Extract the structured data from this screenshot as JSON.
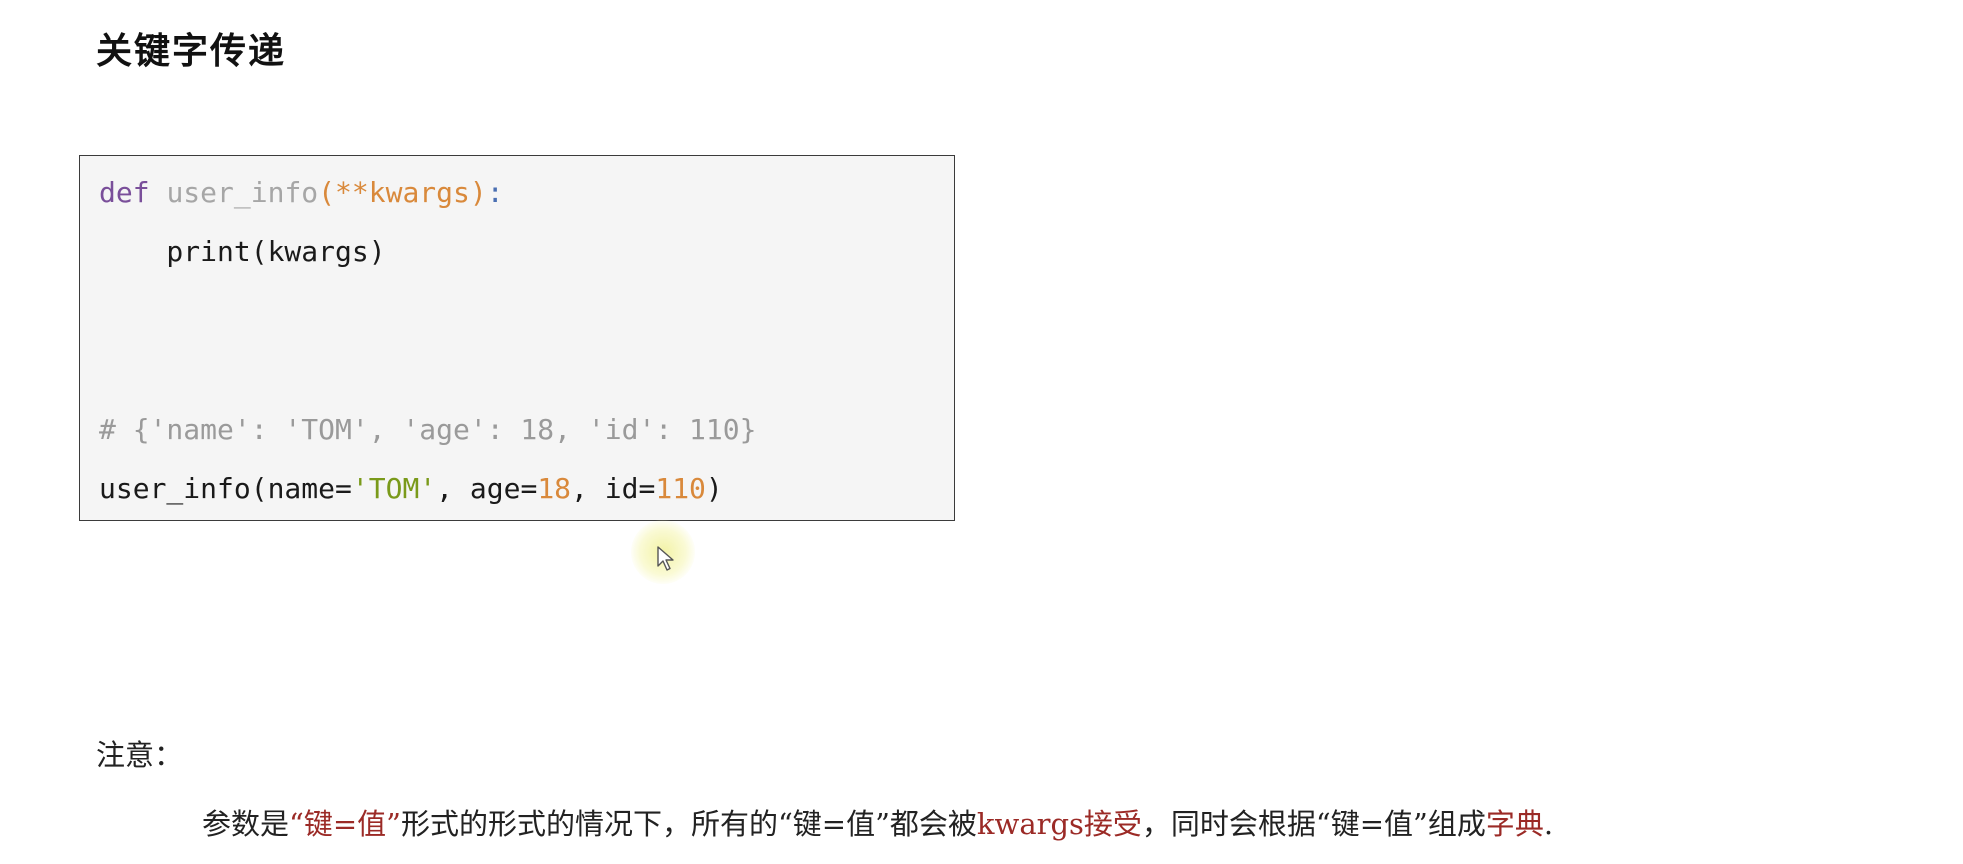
{
  "heading": "关键字传递",
  "code": {
    "line1": {
      "keyword": "def",
      "func_name": "user_info",
      "params": "(**kwargs)",
      "colon": ":"
    },
    "line2": "    print(kwargs)",
    "line3": "# {'name': 'TOM', 'age': 18, 'id': 110}",
    "line4": {
      "prefix": "user_info(name=",
      "str_val": "'TOM'",
      "mid1": ", age=",
      "num1": "18",
      "mid2": ", id=",
      "num2": "110",
      "suffix": ")"
    }
  },
  "note": {
    "label": "注意：",
    "seg1": "参数是",
    "hl1": "“键=值”",
    "seg2": "形式的形式的情况下，所有的“键=值”都会被",
    "hl2": "kwargs接受",
    "seg3": "，同时会根据“键=值”组成",
    "hl3": "字典",
    "seg4": "."
  },
  "colors": {
    "keyword": "#7a4f9a",
    "param": "#d9893b",
    "string": "#7a9a1a",
    "number": "#d9893b",
    "comment": "#9a9a9a",
    "highlight": "#9b2a26",
    "code_bg": "#f5f5f5"
  },
  "icons": [
    "mouse-cursor-icon"
  ]
}
